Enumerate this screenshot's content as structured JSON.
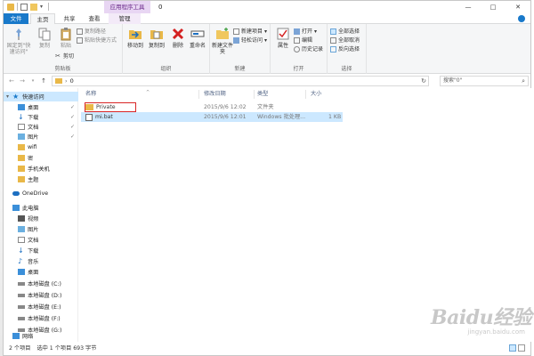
{
  "window": {
    "title": "0",
    "context_tab_header": "应用程序工具",
    "controls": [
      "—",
      "□",
      "✕"
    ]
  },
  "tabs": [
    "文件",
    "主页",
    "共享",
    "查看",
    "管理"
  ],
  "ribbon": {
    "clipboard": {
      "label": "剪贴板",
      "pin": "固定到\"快速访问\"",
      "copy": "复制",
      "paste": "粘贴",
      "cut": "剪切",
      "copy_path": "复制路径",
      "paste_shortcut": "粘贴快捷方式"
    },
    "organize": {
      "label": "组织",
      "move_to": "移动到",
      "copy_to": "复制到",
      "delete": "删除",
      "rename": "重命名"
    },
    "new": {
      "label": "新建",
      "new_folder": "新建文件夹",
      "new_item": "新建项目",
      "easy_access": "轻松访问"
    },
    "open": {
      "label": "打开",
      "properties": "属性",
      "open": "打开",
      "edit": "编辑",
      "history": "历史记录"
    },
    "select": {
      "label": "选择",
      "select_all": "全部选择",
      "select_none": "全部取消",
      "invert": "反向选择"
    }
  },
  "address": {
    "path": "0",
    "search_placeholder": "搜索\"0\""
  },
  "navpane": {
    "quick_access": "快速访问",
    "quick_items": [
      "桌面",
      "下载",
      "文档",
      "图片",
      "wifi",
      "密",
      "手机关机",
      "主题"
    ],
    "onedrive": "OneDrive",
    "this_pc": "此电脑",
    "pc_items": [
      "视频",
      "图片",
      "文档",
      "下载",
      "音乐",
      "桌面"
    ],
    "drives": [
      "本地磁盘 (C:)",
      "本地磁盘 (D:)",
      "本地磁盘 (E:)",
      "本地磁盘 (F:)",
      "本地磁盘 (G:)"
    ],
    "network": "网络"
  },
  "columns": {
    "name": "名称",
    "modified": "修改日期",
    "type": "类型",
    "size": "大小"
  },
  "files": [
    {
      "name": "Private",
      "modified": "2015/9/6 12:02",
      "type": "文件夹",
      "size": ""
    },
    {
      "name": "mi.bat",
      "modified": "2015/9/6 12:01",
      "type": "Windows 批处理...",
      "size": "1 KB"
    }
  ],
  "status": {
    "count": "2 个项目",
    "selected": "选中 1 个项目  693 字节"
  },
  "watermark": {
    "brand": "Baidu经验",
    "site": "jingyan.baidu.com"
  },
  "colors": {
    "accent": "#1979ca",
    "selection": "#cce8ff",
    "context": "#e8d6f3",
    "highlight_box": "#d92626",
    "folder": "#e9b848"
  }
}
